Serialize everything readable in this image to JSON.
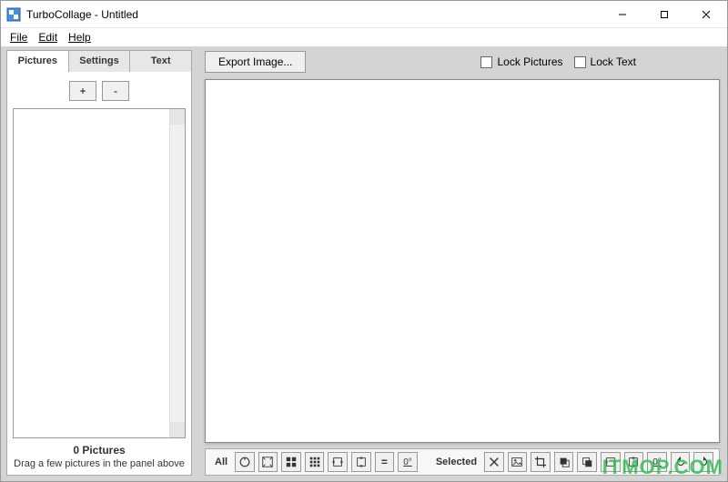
{
  "window": {
    "title": "TurboCollage - Untitled"
  },
  "menu": {
    "file": "File",
    "edit": "Edit",
    "help": "Help"
  },
  "tabs": {
    "pictures": "Pictures",
    "settings": "Settings",
    "text": "Text"
  },
  "left": {
    "add": "+",
    "remove": "-",
    "count_label": "0 Pictures",
    "hint": "Drag a few pictures in the panel above"
  },
  "toolbar": {
    "export": "Export Image...",
    "lock_pictures": "Lock Pictures",
    "lock_text": "Lock Text"
  },
  "bottom": {
    "all": "All",
    "selected": "Selected",
    "eq": "=",
    "zero_u": "0°"
  },
  "watermark": "ITMOP.COM"
}
